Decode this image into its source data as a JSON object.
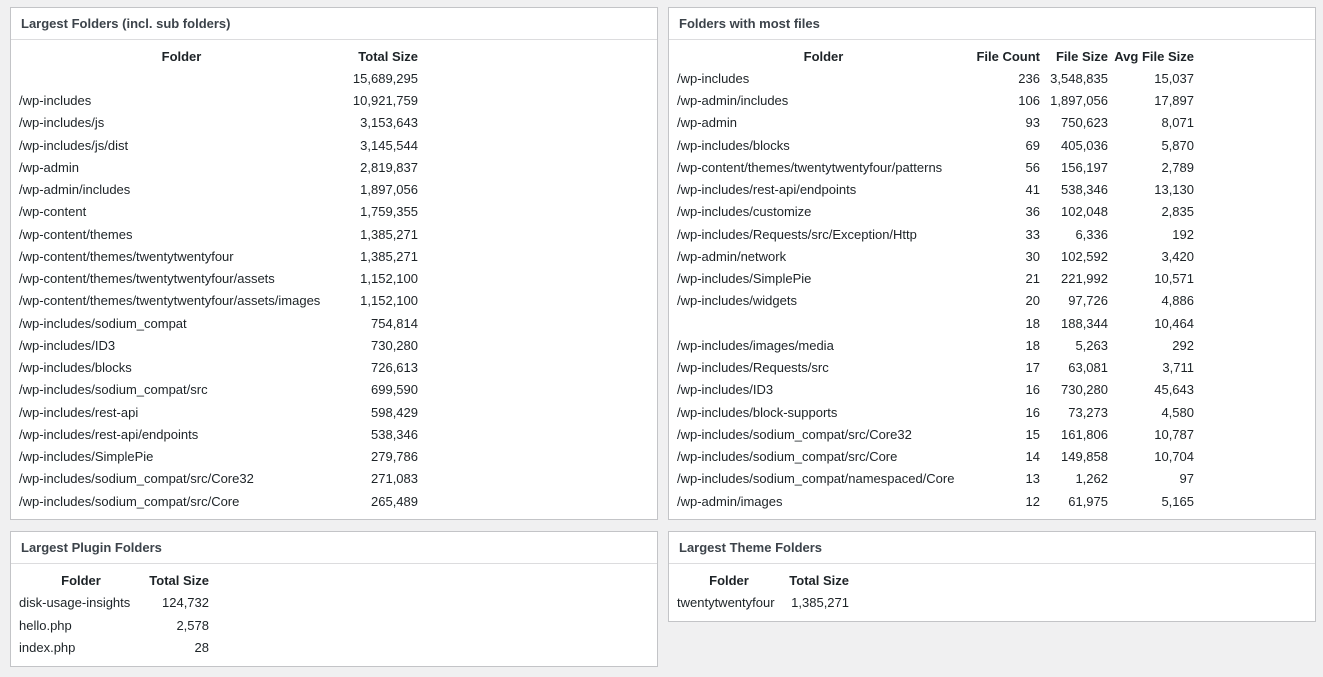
{
  "largest_folders": {
    "title": "Largest Folders (incl. sub folders)",
    "headers": [
      "Folder",
      "Total Size"
    ],
    "rows": [
      [
        "",
        "15,689,295"
      ],
      [
        "/wp-includes",
        "10,921,759"
      ],
      [
        "/wp-includes/js",
        "3,153,643"
      ],
      [
        "/wp-includes/js/dist",
        "3,145,544"
      ],
      [
        "/wp-admin",
        "2,819,837"
      ],
      [
        "/wp-admin/includes",
        "1,897,056"
      ],
      [
        "/wp-content",
        "1,759,355"
      ],
      [
        "/wp-content/themes",
        "1,385,271"
      ],
      [
        "/wp-content/themes/twentytwentyfour",
        "1,385,271"
      ],
      [
        "/wp-content/themes/twentytwentyfour/assets",
        "1,152,100"
      ],
      [
        "/wp-content/themes/twentytwentyfour/assets/images",
        "1,152,100"
      ],
      [
        "/wp-includes/sodium_compat",
        "754,814"
      ],
      [
        "/wp-includes/ID3",
        "730,280"
      ],
      [
        "/wp-includes/blocks",
        "726,613"
      ],
      [
        "/wp-includes/sodium_compat/src",
        "699,590"
      ],
      [
        "/wp-includes/rest-api",
        "598,429"
      ],
      [
        "/wp-includes/rest-api/endpoints",
        "538,346"
      ],
      [
        "/wp-includes/SimplePie",
        "279,786"
      ],
      [
        "/wp-includes/sodium_compat/src/Core32",
        "271,083"
      ],
      [
        "/wp-includes/sodium_compat/src/Core",
        "265,489"
      ]
    ]
  },
  "most_files": {
    "title": "Folders with most files",
    "headers": [
      "Folder",
      "File Count",
      "File Size",
      "Avg File Size"
    ],
    "rows": [
      [
        "/wp-includes",
        "236",
        "3,548,835",
        "15,037"
      ],
      [
        "/wp-admin/includes",
        "106",
        "1,897,056",
        "17,897"
      ],
      [
        "/wp-admin",
        "93",
        "750,623",
        "8,071"
      ],
      [
        "/wp-includes/blocks",
        "69",
        "405,036",
        "5,870"
      ],
      [
        "/wp-content/themes/twentytwentyfour/patterns",
        "56",
        "156,197",
        "2,789"
      ],
      [
        "/wp-includes/rest-api/endpoints",
        "41",
        "538,346",
        "13,130"
      ],
      [
        "/wp-includes/customize",
        "36",
        "102,048",
        "2,835"
      ],
      [
        "/wp-includes/Requests/src/Exception/Http",
        "33",
        "6,336",
        "192"
      ],
      [
        "/wp-admin/network",
        "30",
        "102,592",
        "3,420"
      ],
      [
        "/wp-includes/SimplePie",
        "21",
        "221,992",
        "10,571"
      ],
      [
        "/wp-includes/widgets",
        "20",
        "97,726",
        "4,886"
      ],
      [
        "",
        "18",
        "188,344",
        "10,464"
      ],
      [
        "/wp-includes/images/media",
        "18",
        "5,263",
        "292"
      ],
      [
        "/wp-includes/Requests/src",
        "17",
        "63,081",
        "3,711"
      ],
      [
        "/wp-includes/ID3",
        "16",
        "730,280",
        "45,643"
      ],
      [
        "/wp-includes/block-supports",
        "16",
        "73,273",
        "4,580"
      ],
      [
        "/wp-includes/sodium_compat/src/Core32",
        "15",
        "161,806",
        "10,787"
      ],
      [
        "/wp-includes/sodium_compat/src/Core",
        "14",
        "149,858",
        "10,704"
      ],
      [
        "/wp-includes/sodium_compat/namespaced/Core",
        "13",
        "1,262",
        "97"
      ],
      [
        "/wp-admin/images",
        "12",
        "61,975",
        "5,165"
      ]
    ]
  },
  "plugin_folders": {
    "title": "Largest Plugin Folders",
    "headers": [
      "Folder",
      "Total Size"
    ],
    "rows": [
      [
        "disk-usage-insights",
        "124,732"
      ],
      [
        "hello.php",
        "2,578"
      ],
      [
        "index.php",
        "28"
      ]
    ]
  },
  "theme_folders": {
    "title": "Largest Theme Folders",
    "headers": [
      "Folder",
      "Total Size"
    ],
    "rows": [
      [
        "twentytwentyfour",
        "1,385,271"
      ]
    ]
  }
}
